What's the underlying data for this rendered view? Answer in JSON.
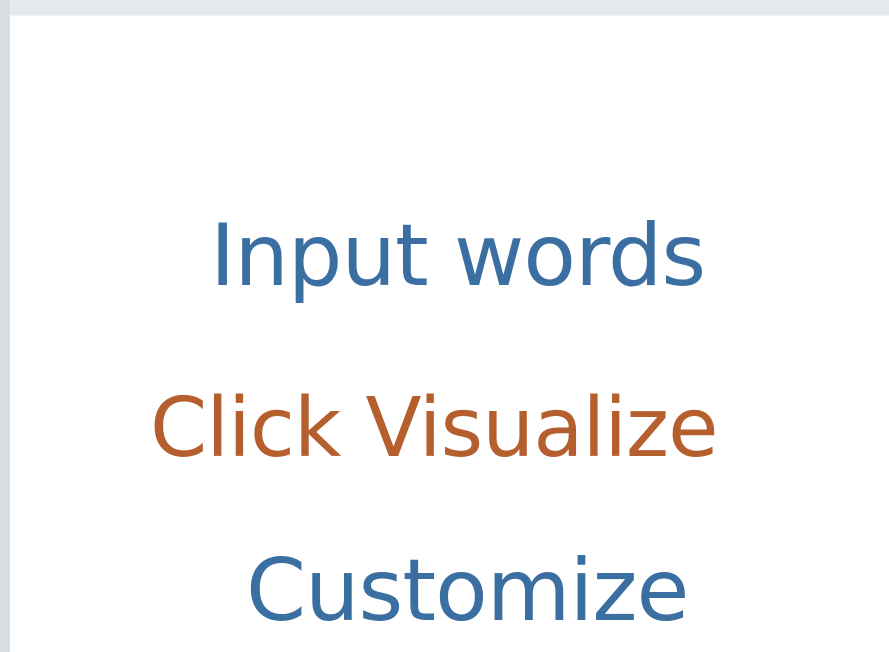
{
  "colors": {
    "primary_blue": "#3c6fa1",
    "accent_orange": "#b65f2e",
    "canvas_bg": "#ffffff",
    "chrome_bg": "#dde1e4"
  },
  "word_cloud": {
    "lines": [
      {
        "text": "Input words",
        "color": "#3c6fa1"
      },
      {
        "text": "Click Visualize",
        "color": "#b65f2e"
      },
      {
        "text": "Customize",
        "color": "#3c6fa1"
      }
    ]
  }
}
